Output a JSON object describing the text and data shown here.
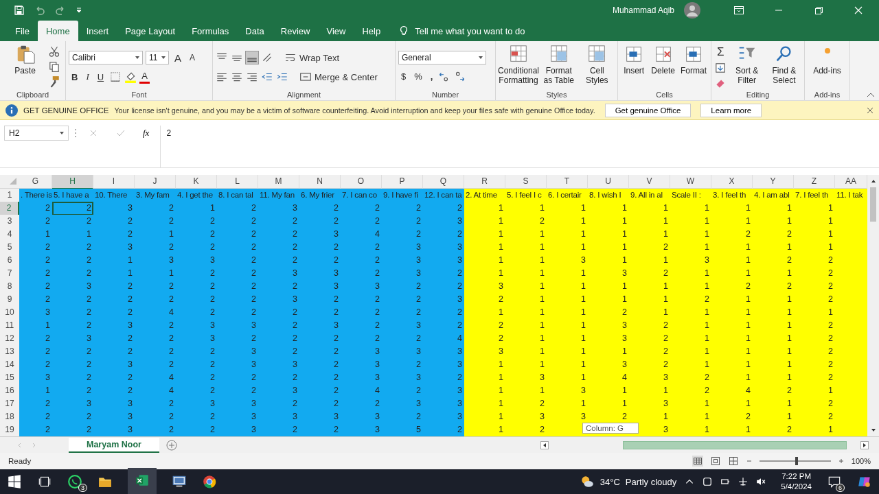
{
  "title_bar": {
    "user": "Muhammad Aqib"
  },
  "menu_tabs": [
    {
      "label": "File",
      "selected": false
    },
    {
      "label": "Home",
      "selected": true
    },
    {
      "label": "Insert",
      "selected": false
    },
    {
      "label": "Page Layout",
      "selected": false
    },
    {
      "label": "Formulas",
      "selected": false
    },
    {
      "label": "Data",
      "selected": false
    },
    {
      "label": "Review",
      "selected": false
    },
    {
      "label": "View",
      "selected": false
    },
    {
      "label": "Help",
      "selected": false
    }
  ],
  "tell_me": "Tell me what you want to do",
  "ribbon": {
    "clipboard": {
      "label": "Clipboard",
      "paste": "Paste"
    },
    "font": {
      "label": "Font",
      "font_name": "Calibri",
      "font_size": "11",
      "grow": "A",
      "shrink": "A",
      "bold": "B",
      "italic": "I",
      "underline": "U",
      "font_color": "A"
    },
    "alignment": {
      "label": "Alignment",
      "wrap_text": "Wrap Text",
      "merge_center": "Merge & Center"
    },
    "number": {
      "label": "Number",
      "format": "General",
      "currency": "$",
      "percent": "%",
      "comma": ","
    },
    "styles": {
      "label": "Styles",
      "buttons": [
        "Conditional Formatting",
        "Format as Table",
        "Cell Styles"
      ]
    },
    "cells": {
      "label": "Cells",
      "buttons": [
        "Insert",
        "Delete",
        "Format"
      ]
    },
    "editing": {
      "label": "Editing",
      "sum": "Σ",
      "buttons": [
        "Sort & Filter",
        "Find & Select"
      ]
    },
    "addins": {
      "label": "Add-ins",
      "button": "Add-ins"
    }
  },
  "message_bar": {
    "title": "GET GENUINE OFFICE",
    "text": "Your license isn't genuine, and you may be a victim of software counterfeiting. Avoid interruption and keep your files safe with genuine Office today.",
    "buttons": [
      "Get genuine Office",
      "Learn more"
    ]
  },
  "formula_bar": {
    "name_box": "H2",
    "fx": "fx",
    "value": "2"
  },
  "sheet": {
    "columns": [
      {
        "letter": "G",
        "selected": false,
        "color": "#12aaf0"
      },
      {
        "letter": "H",
        "selected": true,
        "color": "#12aaf0"
      },
      {
        "letter": "I",
        "selected": false,
        "color": "#12aaf0"
      },
      {
        "letter": "J",
        "selected": false,
        "color": "#12aaf0"
      },
      {
        "letter": "K",
        "selected": false,
        "color": "#12aaf0"
      },
      {
        "letter": "L",
        "selected": false,
        "color": "#12aaf0"
      },
      {
        "letter": "M",
        "selected": false,
        "color": "#12aaf0"
      },
      {
        "letter": "N",
        "selected": false,
        "color": "#12aaf0"
      },
      {
        "letter": "O",
        "selected": false,
        "color": "#12aaf0"
      },
      {
        "letter": "P",
        "selected": false,
        "color": "#12aaf0"
      },
      {
        "letter": "Q",
        "selected": false,
        "color": "#12aaf0"
      },
      {
        "letter": "R",
        "selected": false,
        "color": "#ffff00"
      },
      {
        "letter": "S",
        "selected": false,
        "color": "#ffff00"
      },
      {
        "letter": "T",
        "selected": false,
        "color": "#ffff00"
      },
      {
        "letter": "U",
        "selected": false,
        "color": "#ffff00"
      },
      {
        "letter": "V",
        "selected": false,
        "color": "#ffff00"
      },
      {
        "letter": "W",
        "selected": false,
        "color": "#ffff00"
      },
      {
        "letter": "X",
        "selected": false,
        "color": "#ffff00"
      },
      {
        "letter": "Y",
        "selected": false,
        "color": "#ffff00"
      },
      {
        "letter": "Z",
        "selected": false,
        "color": "#ffff00"
      },
      {
        "letter": "AA",
        "selected": false,
        "color": "#ffff00"
      }
    ],
    "rows": [
      {
        "number": "1",
        "selected": false,
        "cells": [
          ". There is",
          "5. I have a",
          "10. There",
          "3. My fam",
          "4. I get the",
          "8. I can tal",
          "11. My fan",
          "6. My frier",
          "7. I can co",
          "9. I have fi",
          "12. I can ta",
          "2. At time",
          "5. I feel I c",
          "6. I certair",
          "8. I wish I",
          "9. All in al",
          "Scale II :",
          "3. I feel th",
          "4. I am abl",
          "7. I feel th",
          "11. I tak"
        ]
      },
      {
        "number": "2",
        "selected": true,
        "cells": [
          "2",
          "2",
          "3",
          "2",
          "1",
          "2",
          "3",
          "2",
          "2",
          "2",
          "2",
          "1",
          "1",
          "1",
          "1",
          "1",
          "1",
          "1",
          "1",
          "1"
        ]
      },
      {
        "number": "3",
        "selected": false,
        "cells": [
          "2",
          "2",
          "2",
          "2",
          "2",
          "2",
          "2",
          "2",
          "2",
          "2",
          "3",
          "1",
          "2",
          "1",
          "1",
          "1",
          "1",
          "1",
          "1",
          "1"
        ]
      },
      {
        "number": "4",
        "selected": false,
        "cells": [
          "1",
          "1",
          "2",
          "1",
          "2",
          "2",
          "2",
          "3",
          "4",
          "2",
          "2",
          "1",
          "1",
          "1",
          "1",
          "1",
          "1",
          "2",
          "2",
          "1"
        ]
      },
      {
        "number": "5",
        "selected": false,
        "cells": [
          "2",
          "2",
          "3",
          "2",
          "2",
          "2",
          "2",
          "2",
          "2",
          "3",
          "3",
          "1",
          "1",
          "1",
          "1",
          "2",
          "1",
          "1",
          "1",
          "1"
        ]
      },
      {
        "number": "6",
        "selected": false,
        "cells": [
          "2",
          "2",
          "1",
          "3",
          "3",
          "2",
          "2",
          "2",
          "2",
          "3",
          "3",
          "1",
          "1",
          "3",
          "1",
          "1",
          "3",
          "1",
          "2",
          "2"
        ]
      },
      {
        "number": "7",
        "selected": false,
        "cells": [
          "2",
          "2",
          "1",
          "1",
          "2",
          "2",
          "3",
          "3",
          "2",
          "3",
          "2",
          "1",
          "1",
          "1",
          "3",
          "2",
          "1",
          "1",
          "1",
          "2"
        ]
      },
      {
        "number": "8",
        "selected": false,
        "cells": [
          "2",
          "3",
          "2",
          "2",
          "2",
          "2",
          "2",
          "3",
          "3",
          "2",
          "2",
          "3",
          "1",
          "1",
          "1",
          "1",
          "1",
          "2",
          "2",
          "2"
        ]
      },
      {
        "number": "9",
        "selected": false,
        "cells": [
          "2",
          "2",
          "2",
          "2",
          "2",
          "2",
          "3",
          "2",
          "2",
          "2",
          "3",
          "2",
          "1",
          "1",
          "1",
          "1",
          "2",
          "1",
          "1",
          "2"
        ]
      },
      {
        "number": "10",
        "selected": false,
        "cells": [
          "3",
          "2",
          "2",
          "4",
          "2",
          "2",
          "2",
          "2",
          "2",
          "2",
          "2",
          "1",
          "1",
          "1",
          "2",
          "1",
          "1",
          "1",
          "1",
          "1"
        ]
      },
      {
        "number": "11",
        "selected": false,
        "cells": [
          "1",
          "2",
          "3",
          "2",
          "3",
          "3",
          "2",
          "3",
          "2",
          "3",
          "2",
          "2",
          "1",
          "1",
          "3",
          "2",
          "1",
          "1",
          "1",
          "2"
        ]
      },
      {
        "number": "12",
        "selected": false,
        "cells": [
          "2",
          "3",
          "2",
          "2",
          "3",
          "2",
          "2",
          "2",
          "2",
          "2",
          "4",
          "2",
          "1",
          "1",
          "3",
          "2",
          "1",
          "1",
          "1",
          "2"
        ]
      },
      {
        "number": "13",
        "selected": false,
        "cells": [
          "2",
          "2",
          "2",
          "2",
          "2",
          "3",
          "2",
          "2",
          "3",
          "3",
          "3",
          "3",
          "1",
          "1",
          "1",
          "2",
          "1",
          "1",
          "1",
          "2"
        ]
      },
      {
        "number": "14",
        "selected": false,
        "cells": [
          "2",
          "2",
          "3",
          "2",
          "2",
          "3",
          "3",
          "2",
          "3",
          "2",
          "3",
          "1",
          "1",
          "1",
          "3",
          "2",
          "1",
          "1",
          "1",
          "2"
        ]
      },
      {
        "number": "15",
        "selected": false,
        "cells": [
          "3",
          "2",
          "2",
          "4",
          "2",
          "2",
          "2",
          "2",
          "3",
          "3",
          "2",
          "1",
          "3",
          "1",
          "4",
          "3",
          "2",
          "1",
          "1",
          "2"
        ]
      },
      {
        "number": "16",
        "selected": false,
        "cells": [
          "1",
          "2",
          "2",
          "4",
          "2",
          "2",
          "3",
          "2",
          "4",
          "2",
          "3",
          "1",
          "1",
          "3",
          "1",
          "1",
          "2",
          "4",
          "2",
          "1"
        ]
      },
      {
        "number": "17",
        "selected": false,
        "cells": [
          "2",
          "3",
          "3",
          "2",
          "3",
          "3",
          "2",
          "2",
          "2",
          "3",
          "3",
          "1",
          "2",
          "1",
          "1",
          "3",
          "1",
          "1",
          "1",
          "2"
        ]
      },
      {
        "number": "18",
        "selected": false,
        "cells": [
          "2",
          "2",
          "3",
          "2",
          "2",
          "3",
          "3",
          "3",
          "3",
          "2",
          "3",
          "1",
          "3",
          "3",
          "2",
          "1",
          "1",
          "2",
          "1",
          "2"
        ]
      },
      {
        "number": "19",
        "selected": false,
        "cells": [
          "2",
          "2",
          "3",
          "2",
          "2",
          "3",
          "2",
          "2",
          "3",
          "5",
          "2",
          "1",
          "2",
          null,
          null,
          "3",
          "1",
          "1",
          "2",
          "1"
        ]
      }
    ]
  },
  "tooltip": "Column: G",
  "sheet_tabs": [
    {
      "label": "Maryam Noor",
      "selected": true
    }
  ],
  "status_bar": {
    "text": "Ready",
    "zoom": "100%",
    "zoom_slider": {
      "level": 0.52
    }
  },
  "taskbar": {
    "whatsapp_badge": "3",
    "temperature": "34°C",
    "weather": "Partly cloudy",
    "time": "7:22 PM",
    "date": "5/4/2024",
    "notifications": "6"
  }
}
